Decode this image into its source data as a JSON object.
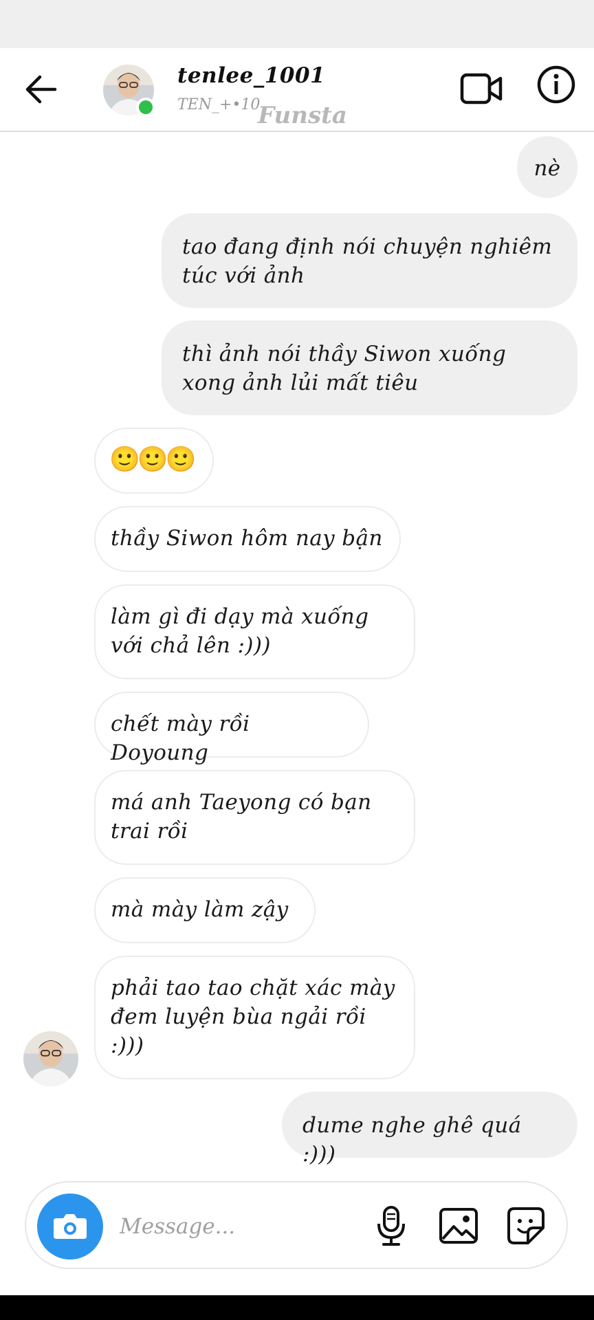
{
  "header": {
    "username": "tenlee_1001",
    "subname": "TEN_+•10",
    "watermark": "Funsta"
  },
  "icons": {
    "back": "arrow-left-icon",
    "video_call": "video-camera-icon",
    "info": "info-icon",
    "camera": "camera-icon",
    "mic": "microphone-icon",
    "gallery": "image-icon",
    "sticker": "sticker-icon"
  },
  "colors": {
    "online": "#2ec04a",
    "camera_button": "#2b95ee",
    "outgoing_bubble": "#efefef",
    "incoming_border": "#ececec"
  },
  "messages": [
    {
      "side": "out",
      "text": "nè"
    },
    {
      "side": "out",
      "text": "tao đang định nói chuyện nghiêm túc với ảnh"
    },
    {
      "side": "out",
      "text": "thì ảnh nói thầy Siwon xuống xong ảnh lủi mất tiêu"
    },
    {
      "side": "in",
      "text": "🙂🙂🙂"
    },
    {
      "side": "in",
      "text": "thầy Siwon hôm nay bận"
    },
    {
      "side": "in",
      "text": "làm gì đi dạy mà xuống với chả lên :)))"
    },
    {
      "side": "in",
      "text": "chết mày rồi Doyoung"
    },
    {
      "side": "in",
      "text": "má anh Taeyong có bạn trai rồi"
    },
    {
      "side": "in",
      "text": "mà mày làm zậy"
    },
    {
      "side": "in",
      "text": "phải tao tao chặt xác mày đem luyện bùa ngải rồi :)))"
    },
    {
      "side": "out",
      "text": "dume nghe ghê quá :)))"
    }
  ],
  "composer": {
    "placeholder": "Message..."
  }
}
